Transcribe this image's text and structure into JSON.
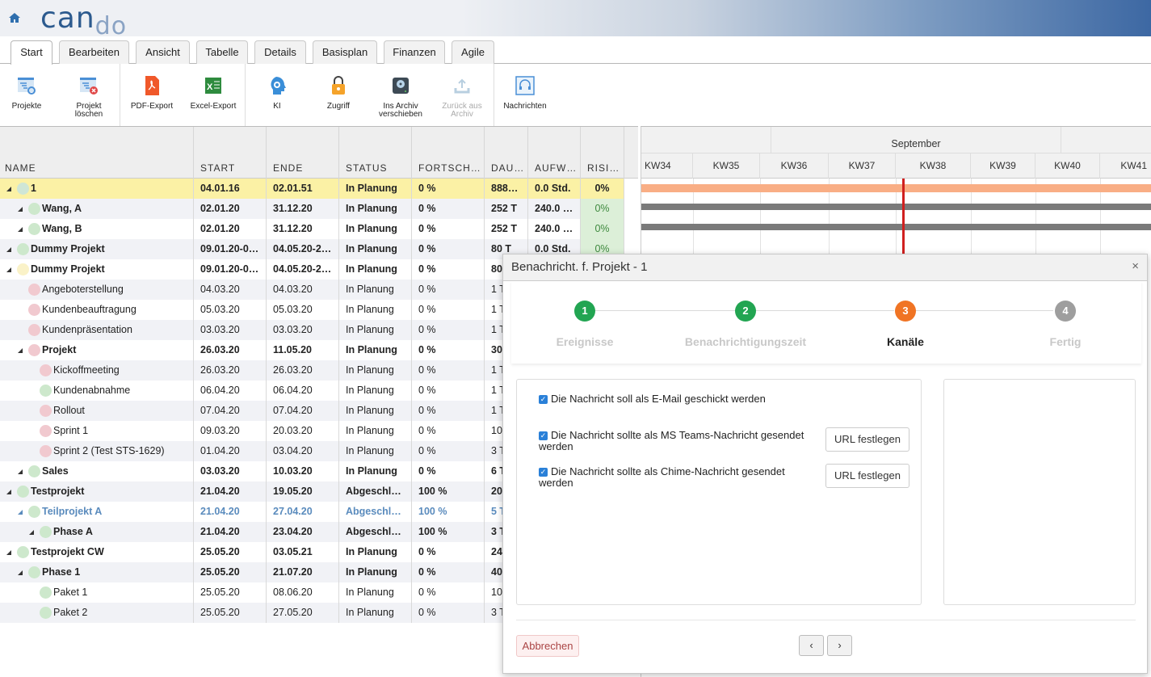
{
  "app": {
    "logo_part1": "can",
    "logo_part2": "do"
  },
  "tabs": [
    {
      "label": "Start",
      "active": true
    },
    {
      "label": "Bearbeiten"
    },
    {
      "label": "Ansicht"
    },
    {
      "label": "Tabelle"
    },
    {
      "label": "Details"
    },
    {
      "label": "Basisplan"
    },
    {
      "label": "Finanzen"
    },
    {
      "label": "Agile"
    }
  ],
  "ribbon": [
    {
      "label1": "Projekte",
      "label2": "",
      "icon": "projects-icon"
    },
    {
      "label1": "Projekt",
      "label2": "löschen",
      "icon": "delete-project-icon"
    },
    {
      "label1": "PDF-Export",
      "label2": "",
      "icon": "pdf-icon"
    },
    {
      "label1": "Excel-Export",
      "label2": "",
      "icon": "excel-icon"
    },
    {
      "label1": "KI",
      "label2": "",
      "icon": "ai-head-icon"
    },
    {
      "label1": "Zugriff",
      "label2": "",
      "icon": "lock-icon"
    },
    {
      "label1": "Ins Archiv",
      "label2": "verschieben",
      "icon": "archive-disk-icon"
    },
    {
      "label1": "Zurück aus",
      "label2": "Archiv",
      "icon": "upload-icon",
      "disabled": true
    },
    {
      "label1": "Nachrichten",
      "label2": "",
      "icon": "headset-icon"
    }
  ],
  "grid": {
    "headers": [
      "NAME",
      "START",
      "ENDE",
      "STATUS",
      "FORTSCH…",
      "DAU…",
      "AUFW…",
      "RISI…"
    ],
    "rows": [
      {
        "name": "1",
        "start": "04.01.16",
        "end": "02.01.51",
        "status": "In Planung",
        "progress": "0 %",
        "duration": "888…",
        "effort": "0.0 Std.",
        "risk": "0%",
        "level": 0,
        "bold": true,
        "expand": true,
        "dot": "#cfe6d6",
        "selected": true
      },
      {
        "name": "Wang, A",
        "start": "02.01.20",
        "end": "31.12.20",
        "status": "In Planung",
        "progress": "0 %",
        "duration": "252 T",
        "effort": "240.0 …",
        "risk": "0%",
        "level": 1,
        "bold": true,
        "expand": true,
        "dot": "#cde8cc"
      },
      {
        "name": "Wang, B",
        "start": "02.01.20",
        "end": "31.12.20",
        "status": "In Planung",
        "progress": "0 %",
        "duration": "252 T",
        "effort": "240.0 …",
        "risk": "0%",
        "level": 1,
        "bold": true,
        "expand": true,
        "dot": "#cde8cc"
      },
      {
        "name": "Dummy Projekt",
        "start": "09.01.20-0…",
        "end": "04.05.20-2…",
        "status": "In Planung",
        "progress": "0 %",
        "duration": "80 T",
        "effort": "0.0 Std.",
        "risk": "0%",
        "level": 0,
        "bold": true,
        "expand": true,
        "dot": "#cde8cc"
      },
      {
        "name": "Dummy Projekt",
        "start": "09.01.20-0…",
        "end": "04.05.20-2…",
        "status": "In Planung",
        "progress": "0 %",
        "duration": "80",
        "level": 0,
        "bold": true,
        "expand": true,
        "dot": "#faf2c8"
      },
      {
        "name": "Angeboterstellung",
        "start": "04.03.20",
        "end": "04.03.20",
        "status": "In Planung",
        "progress": "0 %",
        "duration": "1 T",
        "level": 1,
        "dot": "#f1c9cf"
      },
      {
        "name": "Kundenbeauftragung",
        "start": "05.03.20",
        "end": "05.03.20",
        "status": "In Planung",
        "progress": "0 %",
        "duration": "1 T",
        "level": 1,
        "dot": "#f1c9cf"
      },
      {
        "name": "Kundenpräsentation",
        "start": "03.03.20",
        "end": "03.03.20",
        "status": "In Planung",
        "progress": "0 %",
        "duration": "1 T",
        "level": 1,
        "dot": "#f1c9cf"
      },
      {
        "name": "Projekt",
        "start": "26.03.20",
        "end": "11.05.20",
        "status": "In Planung",
        "progress": "0 %",
        "duration": "30",
        "level": 1,
        "bold": true,
        "expand": true,
        "dot": "#f1c9cf"
      },
      {
        "name": "Kickoffmeeting",
        "start": "26.03.20",
        "end": "26.03.20",
        "status": "In Planung",
        "progress": "0 %",
        "duration": "1 T",
        "level": 2,
        "dot": "#f1c9cf"
      },
      {
        "name": "Kundenabnahme",
        "start": "06.04.20",
        "end": "06.04.20",
        "status": "In Planung",
        "progress": "0 %",
        "duration": "1 T",
        "level": 2,
        "dot": "#cde8cc"
      },
      {
        "name": "Rollout",
        "start": "07.04.20",
        "end": "07.04.20",
        "status": "In Planung",
        "progress": "0 %",
        "duration": "1 T",
        "level": 2,
        "dot": "#f1c9cf"
      },
      {
        "name": "Sprint 1",
        "start": "09.03.20",
        "end": "20.03.20",
        "status": "In Planung",
        "progress": "0 %",
        "duration": "10",
        "level": 2,
        "dot": "#f1c9cf"
      },
      {
        "name": "Sprint 2 (Test STS-1629)",
        "start": "01.04.20",
        "end": "03.04.20",
        "status": "In Planung",
        "progress": "0 %",
        "duration": "3 T",
        "level": 2,
        "dot": "#f1c9cf"
      },
      {
        "name": "Sales",
        "start": "03.03.20",
        "end": "10.03.20",
        "status": "In Planung",
        "progress": "0 %",
        "duration": "6 T",
        "level": 1,
        "bold": true,
        "expand": true,
        "dot": "#cde8cc"
      },
      {
        "name": "Testprojekt",
        "start": "21.04.20",
        "end": "19.05.20",
        "status": "Abgeschl…",
        "progress": "100 %",
        "duration": "20",
        "level": 0,
        "bold": true,
        "expand": true,
        "dot": "#cde8cc"
      },
      {
        "name": "Teilprojekt A",
        "start": "21.04.20",
        "end": "27.04.20",
        "status": "Abgeschl…",
        "progress": "100 %",
        "duration": "5 T",
        "level": 1,
        "bold": true,
        "expand": true,
        "dot": "#cde8cc",
        "blue": true
      },
      {
        "name": "Phase A",
        "start": "21.04.20",
        "end": "23.04.20",
        "status": "Abgeschl…",
        "progress": "100 %",
        "duration": "3 T",
        "level": 2,
        "bold": true,
        "expand": true,
        "dot": "#cde8cc"
      },
      {
        "name": "Testprojekt CW",
        "start": "25.05.20",
        "end": "03.05.21",
        "status": "In Planung",
        "progress": "0 %",
        "duration": "24",
        "level": 0,
        "bold": true,
        "expand": true,
        "dot": "#cde8cc"
      },
      {
        "name": "Phase 1",
        "start": "25.05.20",
        "end": "21.07.20",
        "status": "In Planung",
        "progress": "0 %",
        "duration": "40",
        "level": 1,
        "bold": true,
        "expand": true,
        "dot": "#cde8cc"
      },
      {
        "name": "Paket 1",
        "start": "25.05.20",
        "end": "08.06.20",
        "status": "In Planung",
        "progress": "0 %",
        "duration": "10",
        "level": 2,
        "dot": "#cde8cc"
      },
      {
        "name": "Paket 2",
        "start": "25.05.20",
        "end": "27.05.20",
        "status": "In Planung",
        "progress": "0 %",
        "duration": "3 T",
        "level": 2,
        "dot": "#cde8cc"
      }
    ]
  },
  "gantt": {
    "month": "September",
    "weeks": [
      "KW34",
      "KW35",
      "KW36",
      "KW37",
      "KW38",
      "KW39",
      "KW40",
      "KW41"
    ],
    "bar_colors": [
      "#f9ae85",
      "#7a7a7a",
      "#7a7a7a"
    ],
    "today_color": "#d0201f"
  },
  "modal": {
    "title": "Benachricht. f. Projekt - 1",
    "close": "×",
    "steps": [
      {
        "num": "1",
        "label": "Ereignisse",
        "color": "#22a552"
      },
      {
        "num": "2",
        "label": "Benachrichtigungszeit",
        "color": "#22a552"
      },
      {
        "num": "3",
        "label": "Kanäle",
        "color": "#f07424",
        "current": true
      },
      {
        "num": "4",
        "label": "Fertig",
        "color": "#9e9e9e"
      }
    ],
    "options": [
      {
        "label": "Die Nachricht soll als E-Mail geschickt werden",
        "checked": true
      },
      {
        "label": "Die Nachricht sollte als MS Teams-Nachricht gesendet werden",
        "checked": true,
        "button": "URL festlegen"
      },
      {
        "label": "Die Nachricht sollte als Chime-Nachricht gesendet werden",
        "checked": true,
        "button": "URL festlegen"
      }
    ],
    "cancel": "Abbrechen",
    "prev": "‹",
    "next": "›"
  }
}
